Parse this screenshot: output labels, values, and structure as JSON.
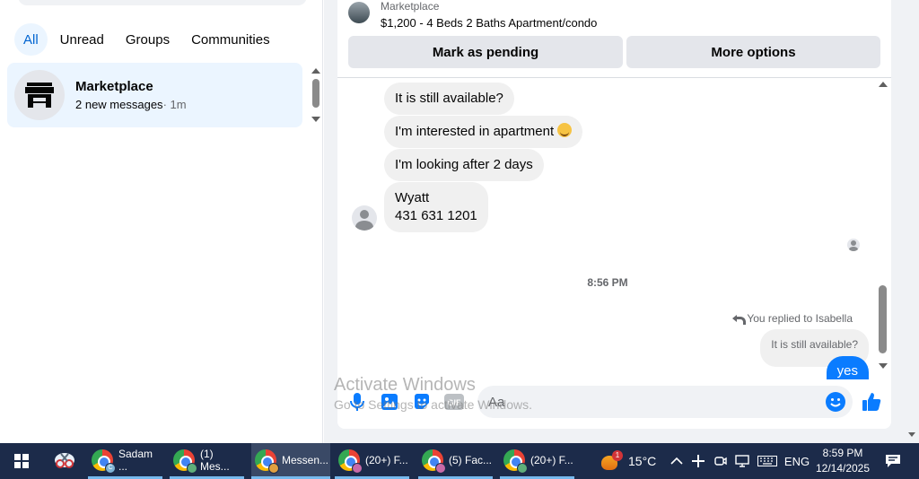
{
  "sidebar": {
    "filters": [
      "All",
      "Unread",
      "Groups",
      "Communities"
    ],
    "active_filter": "All",
    "chats": [
      {
        "name": "Marketplace",
        "preview": "2 new messages",
        "time": "· 1m"
      }
    ]
  },
  "conversation": {
    "listing": {
      "source": "Marketplace",
      "title": "$1,200 - 4 Beds 2 Baths Apartment/condo"
    },
    "buttons": {
      "pending": "Mark as pending",
      "more": "More options"
    },
    "messages_in": [
      "It is still available?",
      "I'm interested in apartment",
      "I'm looking after 2 days",
      "Wyatt\n431 631 1201"
    ],
    "timestamp": "8:56 PM",
    "reply_note": "You replied to Isabella",
    "quoted_text": "It is still available?",
    "outgoing": "yes",
    "composer_placeholder": "Aa",
    "gif_label": "GIF"
  },
  "watermark": {
    "line1": "Activate Windows",
    "line2": "Go to Settings to activate Windows."
  },
  "taskbar": {
    "tasks": [
      {
        "label": "Sadam ...",
        "profile": "C",
        "active": false
      },
      {
        "label": "(1) Mes...",
        "profile": "",
        "active": false
      },
      {
        "label": "Messen...",
        "profile": "",
        "active": true
      },
      {
        "label": "(20+) F...",
        "profile": "",
        "active": false
      },
      {
        "label": "(5) Fac...",
        "profile": "",
        "active": false
      },
      {
        "label": "(20+) F...",
        "profile": "",
        "active": false
      }
    ],
    "weather_badge": "1",
    "temperature": "15°C",
    "language": "ENG",
    "time": "8:59 PM",
    "date": "12/14/2025"
  },
  "colors": {
    "accent": "#0a7cff",
    "active_chip_bg": "#ebf5ff",
    "taskbar_bg": "#1c2b4a"
  }
}
